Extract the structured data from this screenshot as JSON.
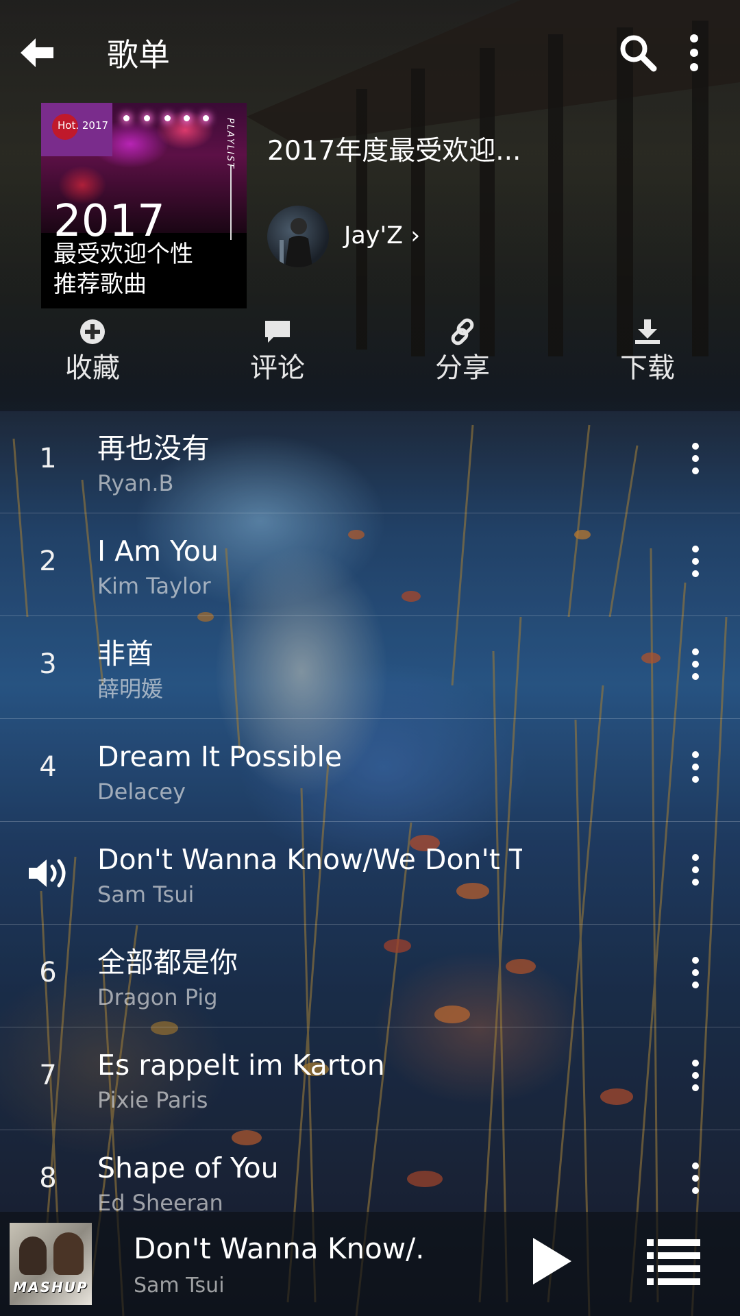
{
  "topbar": {
    "title": "歌单"
  },
  "playlist": {
    "cover": {
      "badge": "Hot. 2017",
      "vertical_text": "PLAYLIST",
      "year": "2017",
      "line1": "最受欢迎个性",
      "line2": "推荐歌曲"
    },
    "title": "2017年度最受欢迎...",
    "creator": "Jay'Z",
    "creator_suffix": "›"
  },
  "actions": [
    {
      "label": "收藏",
      "icon": "add-circle-icon"
    },
    {
      "label": "评论",
      "icon": "comment-icon"
    },
    {
      "label": "分享",
      "icon": "link-icon"
    },
    {
      "label": "下载",
      "icon": "download-icon"
    }
  ],
  "songs": [
    {
      "num": "1",
      "title": "再也没有",
      "artist": "Ryan.B"
    },
    {
      "num": "2",
      "title": "I Am You",
      "artist": "Kim Taylor"
    },
    {
      "num": "3",
      "title": "非酋",
      "artist": "薛明媛"
    },
    {
      "num": "4",
      "title": "Dream It Possible",
      "artist": "Delacey"
    },
    {
      "num": "",
      "title": "Don't Wanna Know/We Don't T...",
      "artist": "Sam Tsui",
      "playing": true
    },
    {
      "num": "6",
      "title": "全部都是你",
      "artist": "Dragon Pig"
    },
    {
      "num": "7",
      "title": "Es rappelt im Karton",
      "artist": "Pixie Paris"
    },
    {
      "num": "8",
      "title": "Shape of You",
      "artist": "Ed Sheeran"
    }
  ],
  "player": {
    "cover_text": "MASHUP",
    "title": "Don't Wanna Know/...",
    "artist": "Sam Tsui"
  }
}
